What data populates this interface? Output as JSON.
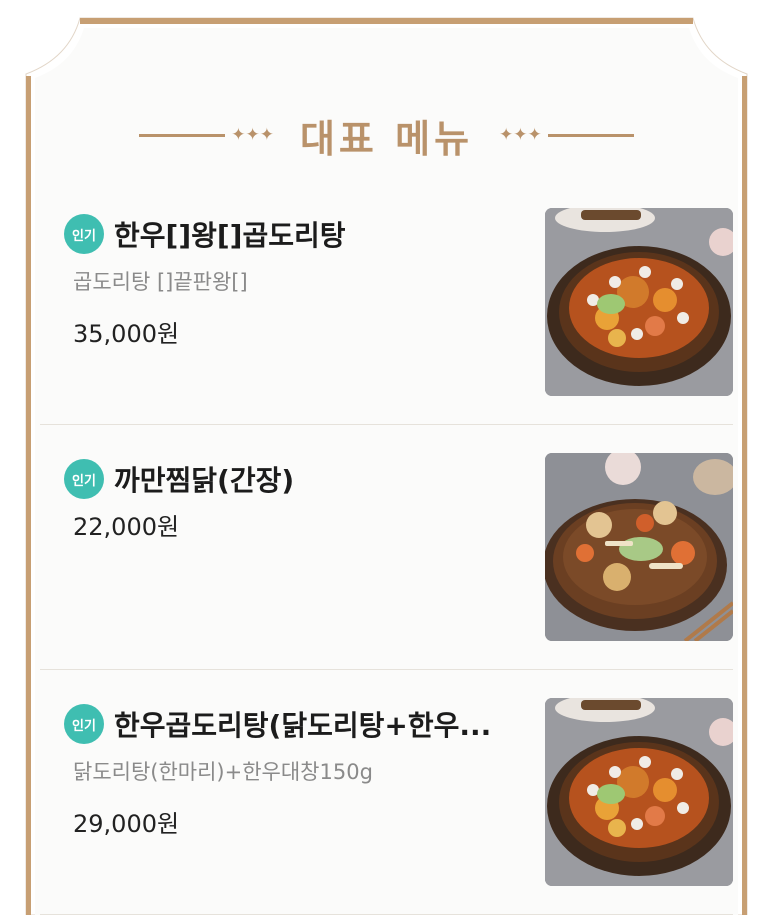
{
  "section": {
    "title": "대표 메뉴",
    "deco_left": "✦✦✦",
    "deco_right": "✦✦✦"
  },
  "colors": {
    "accent": "#b9926a",
    "badge": "#3fbeb1",
    "frame": "#c79f73"
  },
  "menu": [
    {
      "badge": "인기",
      "name": "한우[]왕[]곱도리탕",
      "description": "곱도리탕 []끝판왕[]",
      "price": "35,000원",
      "image": "gopdoritang-dish-photo"
    },
    {
      "badge": "인기",
      "name": "까만찜닭(간장)",
      "description": "",
      "price": "22,000원",
      "image": "braised-chicken-dish-photo"
    },
    {
      "badge": "인기",
      "name": "한우곱도리탕(닭도리탕+한우...",
      "description": "닭도리탕(한마리)+한우대창150g",
      "price": "29,000원",
      "image": "gopdoritang-dish-photo"
    }
  ]
}
